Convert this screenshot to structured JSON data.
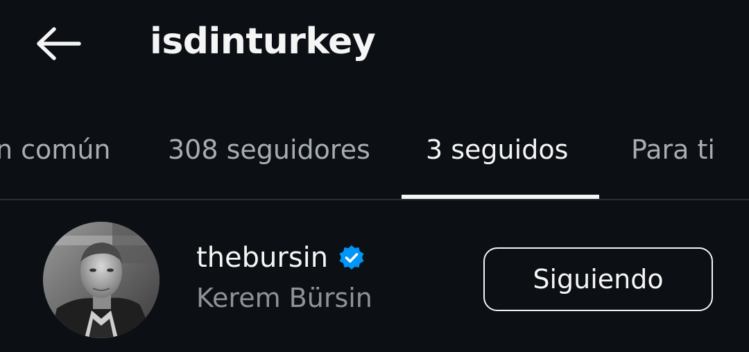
{
  "header": {
    "back_icon": "arrow-left-icon",
    "title": "isdinturkey"
  },
  "tabs": [
    {
      "label": "n común",
      "active": false
    },
    {
      "label": "308 seguidores",
      "active": false
    },
    {
      "label": "3 seguidos",
      "active": true
    },
    {
      "label": "Para ti",
      "active": false
    }
  ],
  "list": {
    "items": [
      {
        "username": "thebursin",
        "verified": true,
        "verified_icon": "verified-badge-icon",
        "full_name": "Kerem Bürsin",
        "button_label": "Siguiendo"
      }
    ]
  },
  "colors": {
    "background": "#0c1014",
    "primary_text": "#f5f5f5",
    "secondary_text": "#8e9399",
    "verified_blue": "#0095f6"
  }
}
